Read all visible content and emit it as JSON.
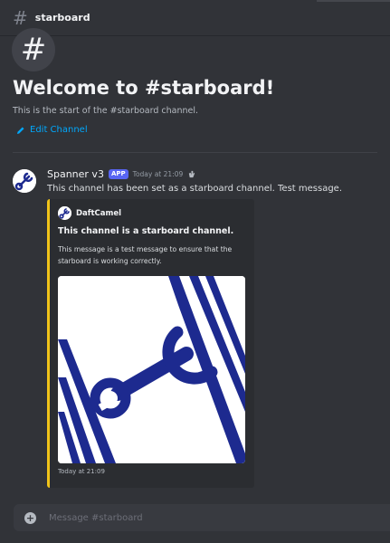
{
  "channel": {
    "name": "starboard",
    "hash_icon": "hash-icon"
  },
  "welcome": {
    "title": "Welcome to #starboard!",
    "subtitle": "This is the start of the #starboard channel.",
    "edit_label": "Edit Channel"
  },
  "message": {
    "author": "Spanner v3",
    "badge": "APP",
    "timestamp": "Today at 21:09",
    "text": "This channel has been set as a starboard channel. Test message.",
    "embed": {
      "accent_color": "#f0c419",
      "author": "DaftCamel",
      "title": "This channel is a starboard channel.",
      "description": "This message is a test message to ensure that the starboard is working correctly.",
      "footer": "Today at 21:09"
    }
  },
  "composer": {
    "placeholder": "Message #starboard"
  },
  "colors": {
    "background": "#313338",
    "link": "#00a8fc",
    "badge": "#5865f2",
    "wrench": "#1d2a8f"
  }
}
